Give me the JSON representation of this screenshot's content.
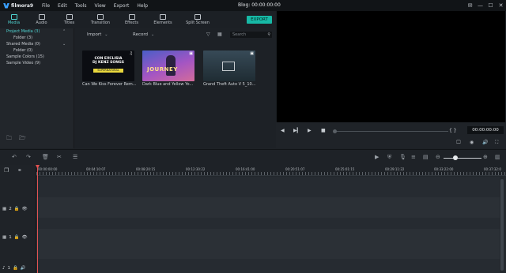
{
  "app": {
    "name": "filmora9",
    "title": "Blog:  00:00:00:00"
  },
  "menu": [
    "File",
    "Edit",
    "Tools",
    "View",
    "Export",
    "Help"
  ],
  "window_controls": [
    "✉",
    "—",
    "☐",
    "✕"
  ],
  "tabs": [
    {
      "label": "Media",
      "active": true
    },
    {
      "label": "Audio"
    },
    {
      "label": "Titles"
    },
    {
      "label": "Transition"
    },
    {
      "label": "Effects"
    },
    {
      "label": "Elements"
    },
    {
      "label": "Split Screen"
    }
  ],
  "export_label": "EXPORT",
  "sidebar": {
    "items": [
      {
        "label": "Project Media (3)",
        "active": true,
        "sub": false,
        "chevron": "⌃"
      },
      {
        "label": "Folder (3)",
        "sub": true
      },
      {
        "label": "Shared Media (0)",
        "sub": false,
        "chevron": "⌄"
      },
      {
        "label": "Folder (0)",
        "sub": true
      },
      {
        "label": "Sample Colors (15)",
        "sub": false
      },
      {
        "label": "Sample Video (9)",
        "sub": false
      }
    ]
  },
  "media_toolbar": {
    "import_label": "Import",
    "record_label": "Record",
    "search_placeholder": "Search"
  },
  "media_items": [
    {
      "label": "Can We Kiss Forever Rem...",
      "thumb_text_1": "CON EXCLISIA DJ KENZ SONGS",
      "thumb_text_2": "SUPERNATURAL"
    },
    {
      "label": "Dark Blue and Yellow Yo...",
      "thumb_text_1": "JOURNEY"
    },
    {
      "label": "Grand Theft Auto V 5_10..."
    }
  ],
  "preview": {
    "timecode": "00:00:00:00",
    "brackets": "{   }"
  },
  "ruler_ticks": [
    "00:00:00:00",
    "00:04:10:07",
    "00:08:20:15",
    "00:12:30:22",
    "00:16:41:00",
    "00:20:51:07",
    "00:25:01:15",
    "00:29:11:22",
    "00:33:22:00",
    "00:37:32:0"
  ],
  "tracks": [
    {
      "id": "2",
      "label": "2"
    },
    {
      "id": "1",
      "label": "1"
    },
    {
      "id": "audio1",
      "label": "1"
    }
  ],
  "colors": {
    "accent": "#4fd2d0",
    "export": "#17b9a6",
    "playhead": "#e25252"
  }
}
